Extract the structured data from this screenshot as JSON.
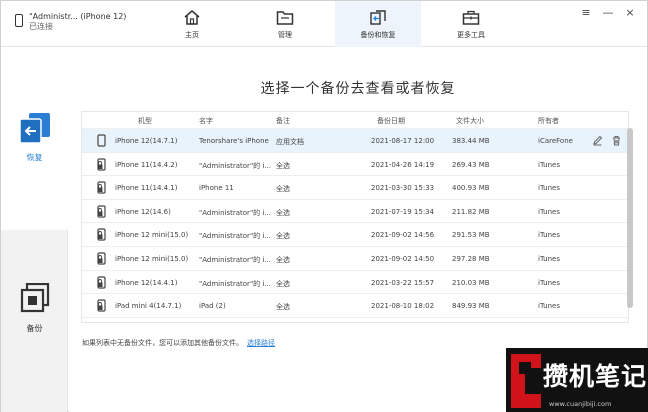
{
  "device": {
    "name": "\"Administr... (iPhone 12)",
    "status": "已连接"
  },
  "tabs": [
    {
      "label": "主页",
      "icon": "home-icon"
    },
    {
      "label": "管理",
      "icon": "folder-icon"
    },
    {
      "label": "备份和恢复",
      "icon": "backup-restore-icon"
    },
    {
      "label": "更多工具",
      "icon": "toolbox-icon"
    }
  ],
  "active_tab": "备份和恢复",
  "window_controls": [
    "≡",
    "—",
    "×"
  ],
  "sidebar": {
    "restore_label": "恢复",
    "backup_label": "备份"
  },
  "main": {
    "title": "选择一个备份去查看或者恢复",
    "columns": [
      "机型",
      "名字",
      "备注",
      "备份日期",
      "文件大小",
      "所有者"
    ],
    "rows": [
      {
        "model": "iPhone 12(14.7.1)",
        "name": "Tenorshare's iPhone",
        "note": "应用文档",
        "date": "2021-08-17 12:00",
        "size": "383.44 MB",
        "owner": "iCareFone",
        "selected": true
      },
      {
        "model": "iPhone 11(14.4.2)",
        "name": "\"Administrator\"的 i...",
        "note": "全选",
        "date": "2021-04-26 14:19",
        "size": "269.43 MB",
        "owner": "iTunes"
      },
      {
        "model": "iPhone 11(14.4.1)",
        "name": "iPhone 11",
        "note": "全选",
        "date": "2021-03-30 15:33",
        "size": "400.93 MB",
        "owner": "iTunes"
      },
      {
        "model": "iPhone 12(14.6)",
        "name": "\"Administrator\"的 i...",
        "note": "全选",
        "date": "2021-07-19 15:34",
        "size": "211.82 MB",
        "owner": "iTunes"
      },
      {
        "model": "iPhone 12 mini(15.0)",
        "name": "\"Administrator\"的 i...",
        "note": "全选",
        "date": "2021-09-02 14:56",
        "size": "291.53 MB",
        "owner": "iTunes"
      },
      {
        "model": "iPhone 12 mini(15.0)",
        "name": "\"Administrator\"的 i...",
        "note": "全选",
        "date": "2021-09-02 14:50",
        "size": "297.28 MB",
        "owner": "iTunes"
      },
      {
        "model": "iPhone 12(14.4.1)",
        "name": "\"Administrator\"的 i...",
        "note": "全选",
        "date": "2021-03-22 15:57",
        "size": "210.03 MB",
        "owner": "iTunes"
      },
      {
        "model": "iPad mini 4(14.7.1)",
        "name": "iPad (2)",
        "note": "全选",
        "date": "2021-08-10 18:02",
        "size": "849.93 MB",
        "owner": "iTunes"
      }
    ],
    "footer_text": "如果列表中无备份文件，您可以添加其他备份文件。",
    "footer_link": "选择路径"
  },
  "watermark": {
    "text": "攒机笔记",
    "url": "www.cuanjibiji.com"
  },
  "colors": {
    "accent": "#2a7fd4",
    "selected_row": "#e9f3fc",
    "active_tab": "#eef4fb"
  }
}
